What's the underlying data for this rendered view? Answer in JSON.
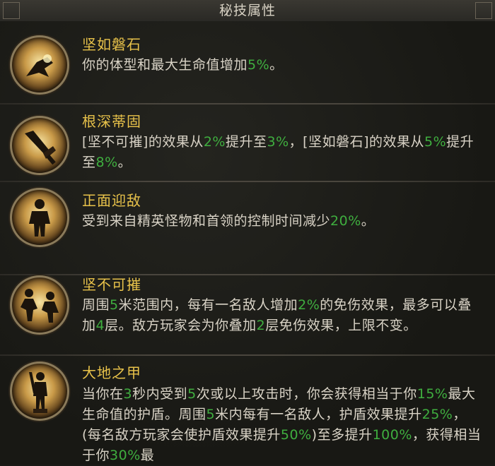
{
  "header": {
    "title": "秘技属性"
  },
  "colors": {
    "title": "#e8c24a",
    "text": "#d9d3c6",
    "highlight": "#3fae3f"
  },
  "skills": [
    {
      "icon": "stone-fist-icon",
      "name": "坚如磐石",
      "desc": [
        {
          "t": "你的体型和最大生命值增加"
        },
        {
          "t": "5%",
          "h": true
        },
        {
          "t": "。"
        }
      ]
    },
    {
      "icon": "deep-roots-sword-icon",
      "name": "根深蒂固",
      "desc": [
        {
          "t": "[坚不可摧]的效果从"
        },
        {
          "t": "2%",
          "h": true
        },
        {
          "t": "提升至"
        },
        {
          "t": "3%",
          "h": true
        },
        {
          "t": "，[坚如磐石]的效果从"
        },
        {
          "t": "5%",
          "h": true
        },
        {
          "t": "提升至"
        },
        {
          "t": "8%",
          "h": true
        },
        {
          "t": "。"
        }
      ]
    },
    {
      "icon": "warrior-stance-icon",
      "name": "正面迎敌",
      "desc": [
        {
          "t": "受到来自精英怪物和首领的控制时间减少"
        },
        {
          "t": "20%",
          "h": true
        },
        {
          "t": "。"
        }
      ]
    },
    {
      "icon": "fighters-clash-icon",
      "name": "坚不可摧",
      "desc": [
        {
          "t": "周围"
        },
        {
          "t": "5",
          "h": true
        },
        {
          "t": "米范围内，每有一名敌人增加"
        },
        {
          "t": "2%",
          "h": true
        },
        {
          "t": "的免伤效果，最多可以叠加"
        },
        {
          "t": "4",
          "h": true
        },
        {
          "t": "层。敌方玩家会为你叠加"
        },
        {
          "t": "2",
          "h": true
        },
        {
          "t": "层免伤效果，上限不变。"
        }
      ]
    },
    {
      "icon": "earth-armor-warrior-icon",
      "name": "大地之甲",
      "desc": [
        {
          "t": "当你在"
        },
        {
          "t": "3",
          "h": true
        },
        {
          "t": "秒内受到"
        },
        {
          "t": "5",
          "h": true
        },
        {
          "t": "次或以上攻击时，你会获得相当于你"
        },
        {
          "t": "15%",
          "h": true
        },
        {
          "t": "最大生命值的护盾。周围"
        },
        {
          "t": "5",
          "h": true
        },
        {
          "t": "米内每有一名敌人，护盾效果提升"
        },
        {
          "t": "25%",
          "h": true
        },
        {
          "t": "，(每名敌方玩家会使护盾效果提升"
        },
        {
          "t": "50%",
          "h": true
        },
        {
          "t": ")至多提升"
        },
        {
          "t": "100%",
          "h": true
        },
        {
          "t": "，获得相当于你"
        },
        {
          "t": "30%",
          "h": true
        },
        {
          "t": "最"
        }
      ]
    }
  ]
}
